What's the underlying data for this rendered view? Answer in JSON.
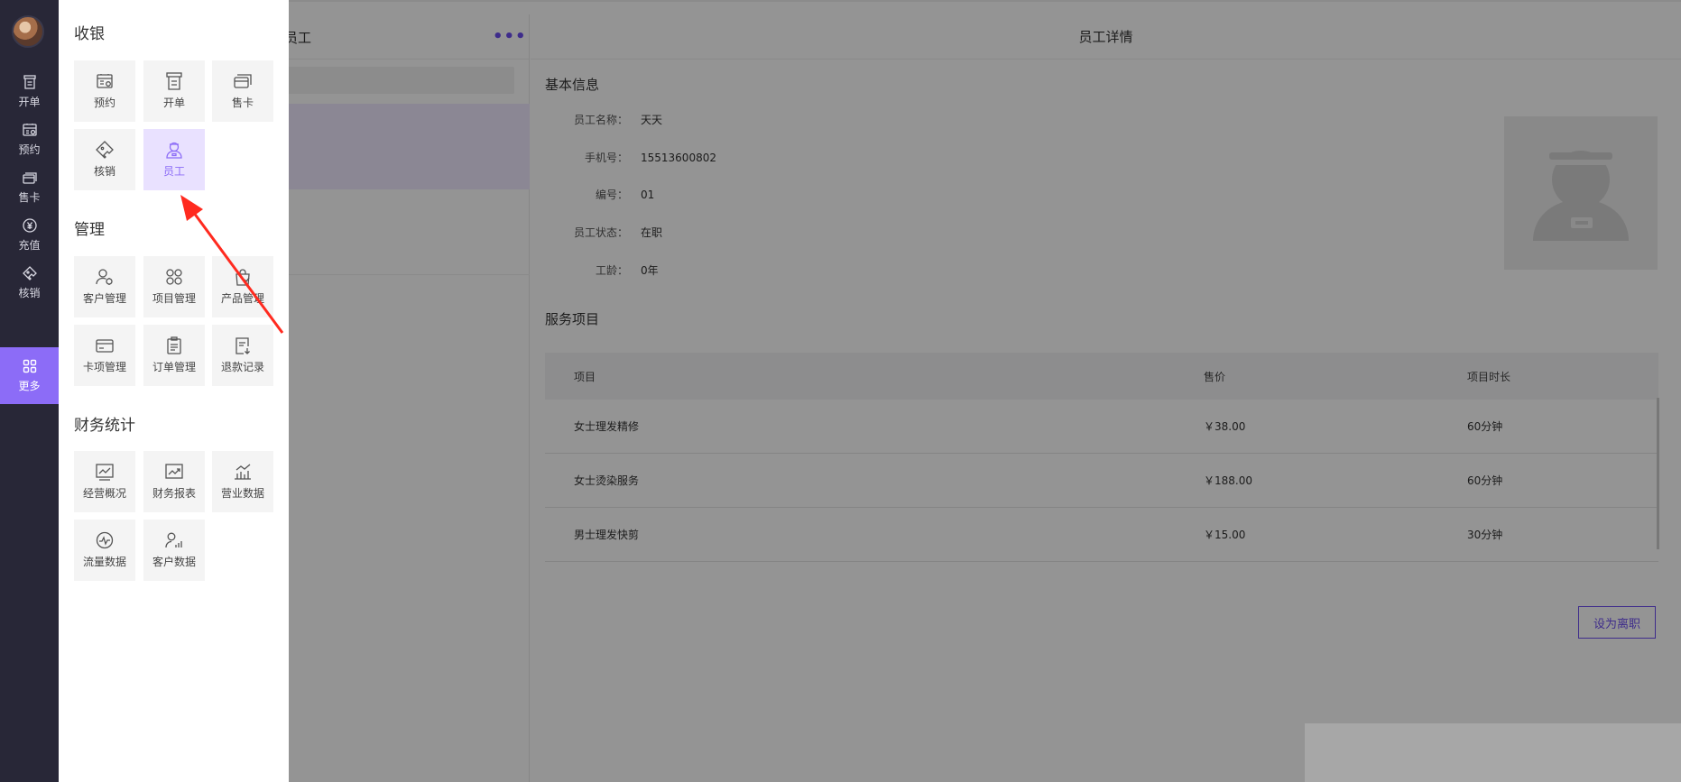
{
  "nav": {
    "items": [
      {
        "label": "开单",
        "icon": "receipt-icon"
      },
      {
        "label": "预约",
        "icon": "calendar-icon"
      },
      {
        "label": "售卡",
        "icon": "card-icon"
      },
      {
        "label": "充值",
        "icon": "yen-coin-icon"
      },
      {
        "label": "核销",
        "icon": "ticket-icon"
      },
      {
        "label": "更多",
        "icon": "grid-icon"
      }
    ]
  },
  "list": {
    "title": "员工"
  },
  "detail": {
    "title": "员工详情",
    "basic_title": "基本信息",
    "fields": [
      {
        "key": "员工名称：",
        "value": "天天"
      },
      {
        "key": "手机号：",
        "value": "15513600802"
      },
      {
        "key": "编号：",
        "value": "01"
      },
      {
        "key": "员工状态：",
        "value": "在职"
      },
      {
        "key": "工龄：",
        "value": "0年"
      }
    ],
    "service_title": "服务项目",
    "service_headers": [
      "项目",
      "售价",
      "项目时长"
    ],
    "services": [
      {
        "name": "女士理发精修",
        "price": "￥38.00",
        "duration": "60分钟"
      },
      {
        "name": "女士烫染服务",
        "price": "￥188.00",
        "duration": "60分钟"
      },
      {
        "name": "男士理发快剪",
        "price": "￥15.00",
        "duration": "30分钟"
      }
    ],
    "resign_label": "设为离职"
  },
  "drawer": {
    "groups": [
      {
        "title": "收银",
        "tiles": [
          {
            "label": "预约",
            "icon": "calendar-icon"
          },
          {
            "label": "开单",
            "icon": "receipt-icon"
          },
          {
            "label": "售卡",
            "icon": "card-icon"
          },
          {
            "label": "核销",
            "icon": "ticket-icon"
          },
          {
            "label": "员工",
            "icon": "staff-icon"
          }
        ]
      },
      {
        "title": "管理",
        "tiles": [
          {
            "label": "客户管理",
            "icon": "customer-icon"
          },
          {
            "label": "项目管理",
            "icon": "project-icon"
          },
          {
            "label": "产品管理",
            "icon": "product-icon"
          },
          {
            "label": "卡项管理",
            "icon": "card-manage-icon"
          },
          {
            "label": "订单管理",
            "icon": "order-icon"
          },
          {
            "label": "退款记录",
            "icon": "refund-icon"
          }
        ]
      },
      {
        "title": "财务统计",
        "tiles": [
          {
            "label": "经营概况",
            "icon": "line-chart-icon"
          },
          {
            "label": "财务报表",
            "icon": "report-icon"
          },
          {
            "label": "营业数据",
            "icon": "bar-trend-icon"
          },
          {
            "label": "流量数据",
            "icon": "pulse-icon"
          },
          {
            "label": "客户数据",
            "icon": "user-chart-icon"
          }
        ]
      }
    ]
  },
  "colors": {
    "accent": "#8c6cf7",
    "nav_bg": "#282737",
    "arrow": "#ff2a1f"
  }
}
